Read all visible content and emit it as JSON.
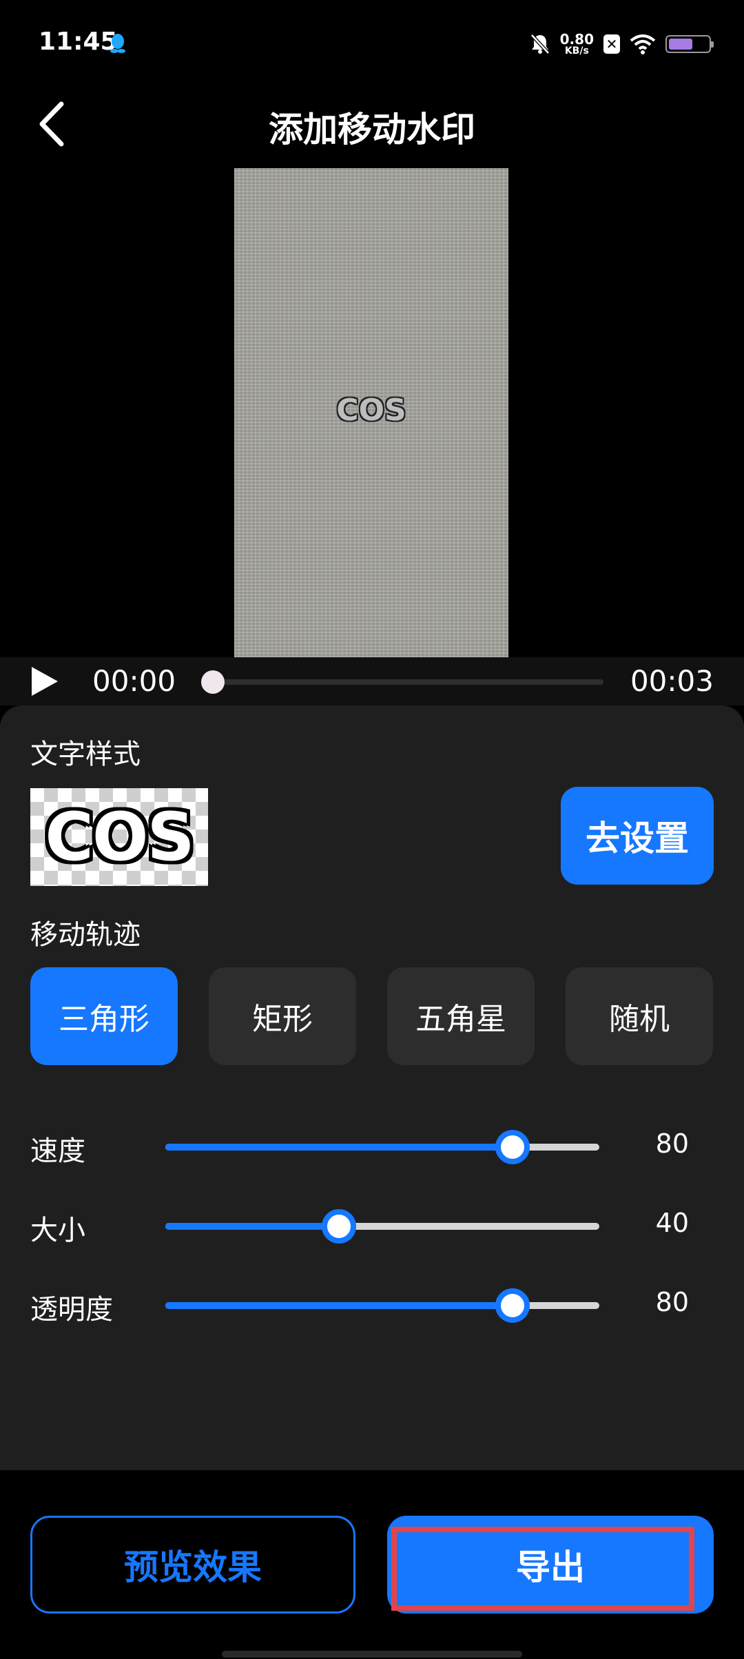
{
  "status_bar": {
    "time": "11:45",
    "net_speed_value": "0.80",
    "net_speed_unit": "KB/s",
    "sim_label": "✕",
    "icons": [
      "qq-icon",
      "mute-bell-icon",
      "wifi-icon",
      "battery-icon"
    ],
    "battery_color": "#a67be6"
  },
  "header": {
    "title": "添加移动水印",
    "back_icon": "chevron-left-icon"
  },
  "video": {
    "watermark_text": "COS",
    "current_time": "00:00",
    "total_time": "00:03",
    "progress": 0.0
  },
  "text_style": {
    "label": "文字样式",
    "preview_text": "COS",
    "setup_button": "去设置"
  },
  "trajectory": {
    "label": "移动轨迹",
    "options": [
      "三角形",
      "矩形",
      "五角星",
      "随机"
    ],
    "selected": "三角形"
  },
  "sliders": [
    {
      "label": "速度",
      "value": "80",
      "percent": 0.8
    },
    {
      "label": "大小",
      "value": "40",
      "percent": 0.4
    },
    {
      "label": "透明度",
      "value": "80",
      "percent": 0.8
    }
  ],
  "actions": {
    "preview": "预览效果",
    "export": "导出"
  },
  "colors": {
    "accent": "#1677ff",
    "panel_bg": "#1f1f1f",
    "highlight": "#e0454b"
  }
}
